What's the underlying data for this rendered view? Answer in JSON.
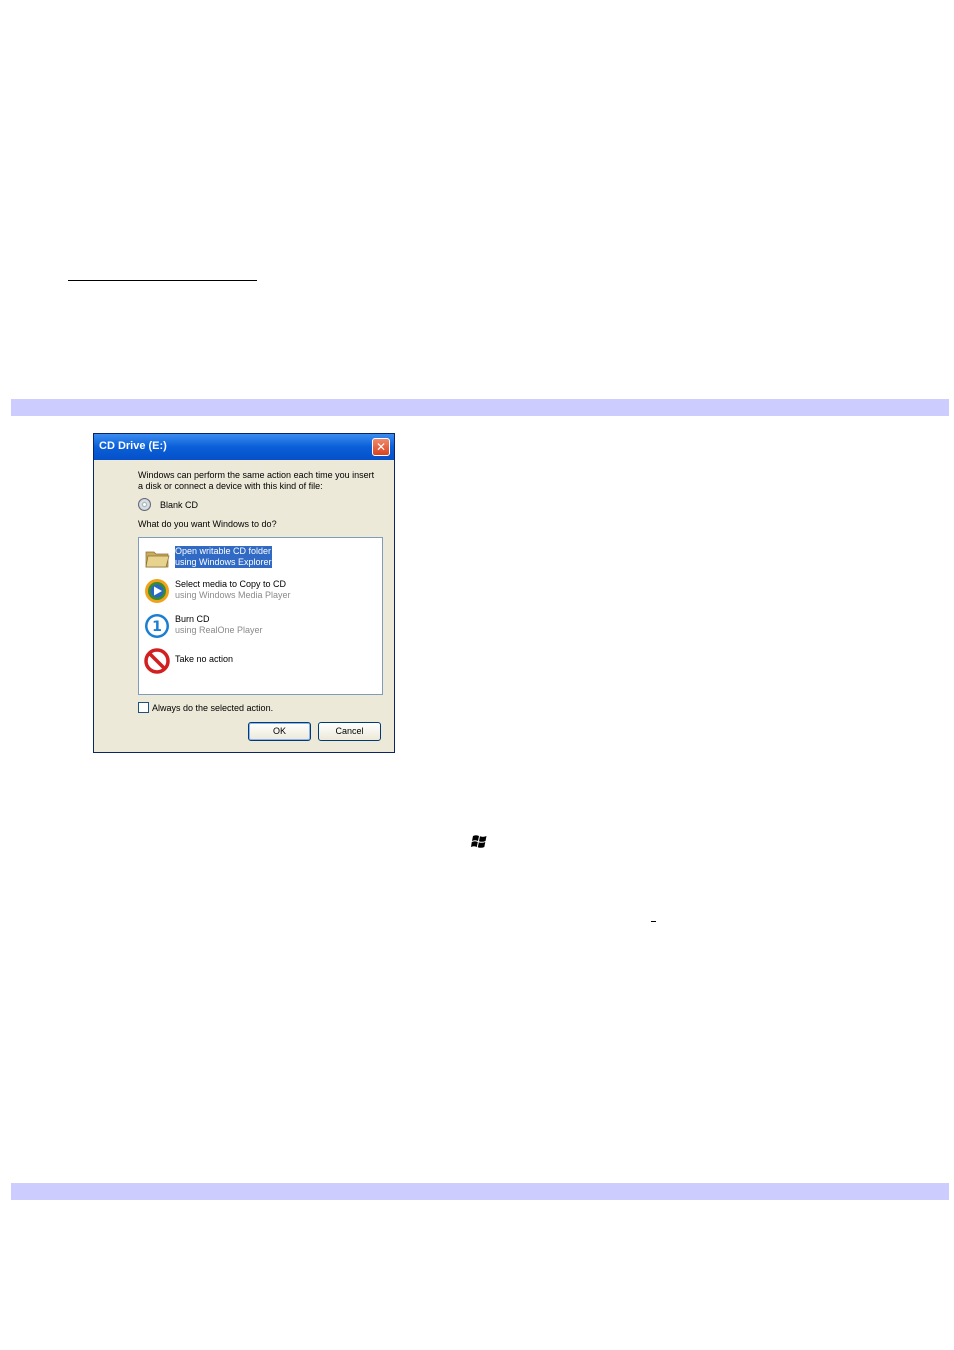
{
  "dialog": {
    "title": "CD Drive (E:)",
    "close_label": "✕",
    "prompt_line1": "Windows can perform the same action each time you insert",
    "prompt_line2": "a disk or connect a device with this kind of file:",
    "media_type": "Blank CD",
    "question": "What do you want Windows to do?",
    "actions": [
      {
        "primary": "Open writable CD folder",
        "secondary": "using Windows Explorer",
        "icon": "folder-icon",
        "selected": true
      },
      {
        "primary": "Select media to Copy to CD",
        "secondary": "using Windows Media Player",
        "icon": "media-player-icon",
        "selected": false
      },
      {
        "primary": "Burn CD",
        "secondary": "using RealOne Player",
        "icon": "realone-icon",
        "selected": false
      },
      {
        "primary": "Take no action",
        "secondary": "",
        "icon": "no-action-icon",
        "selected": false
      }
    ],
    "always_label": "Always do the selected action.",
    "ok_label": "OK",
    "cancel_label": "Cancel"
  },
  "colors": {
    "band": "#ccccff",
    "selection": "#316ac5",
    "titlebar": "#0a5fd8"
  }
}
